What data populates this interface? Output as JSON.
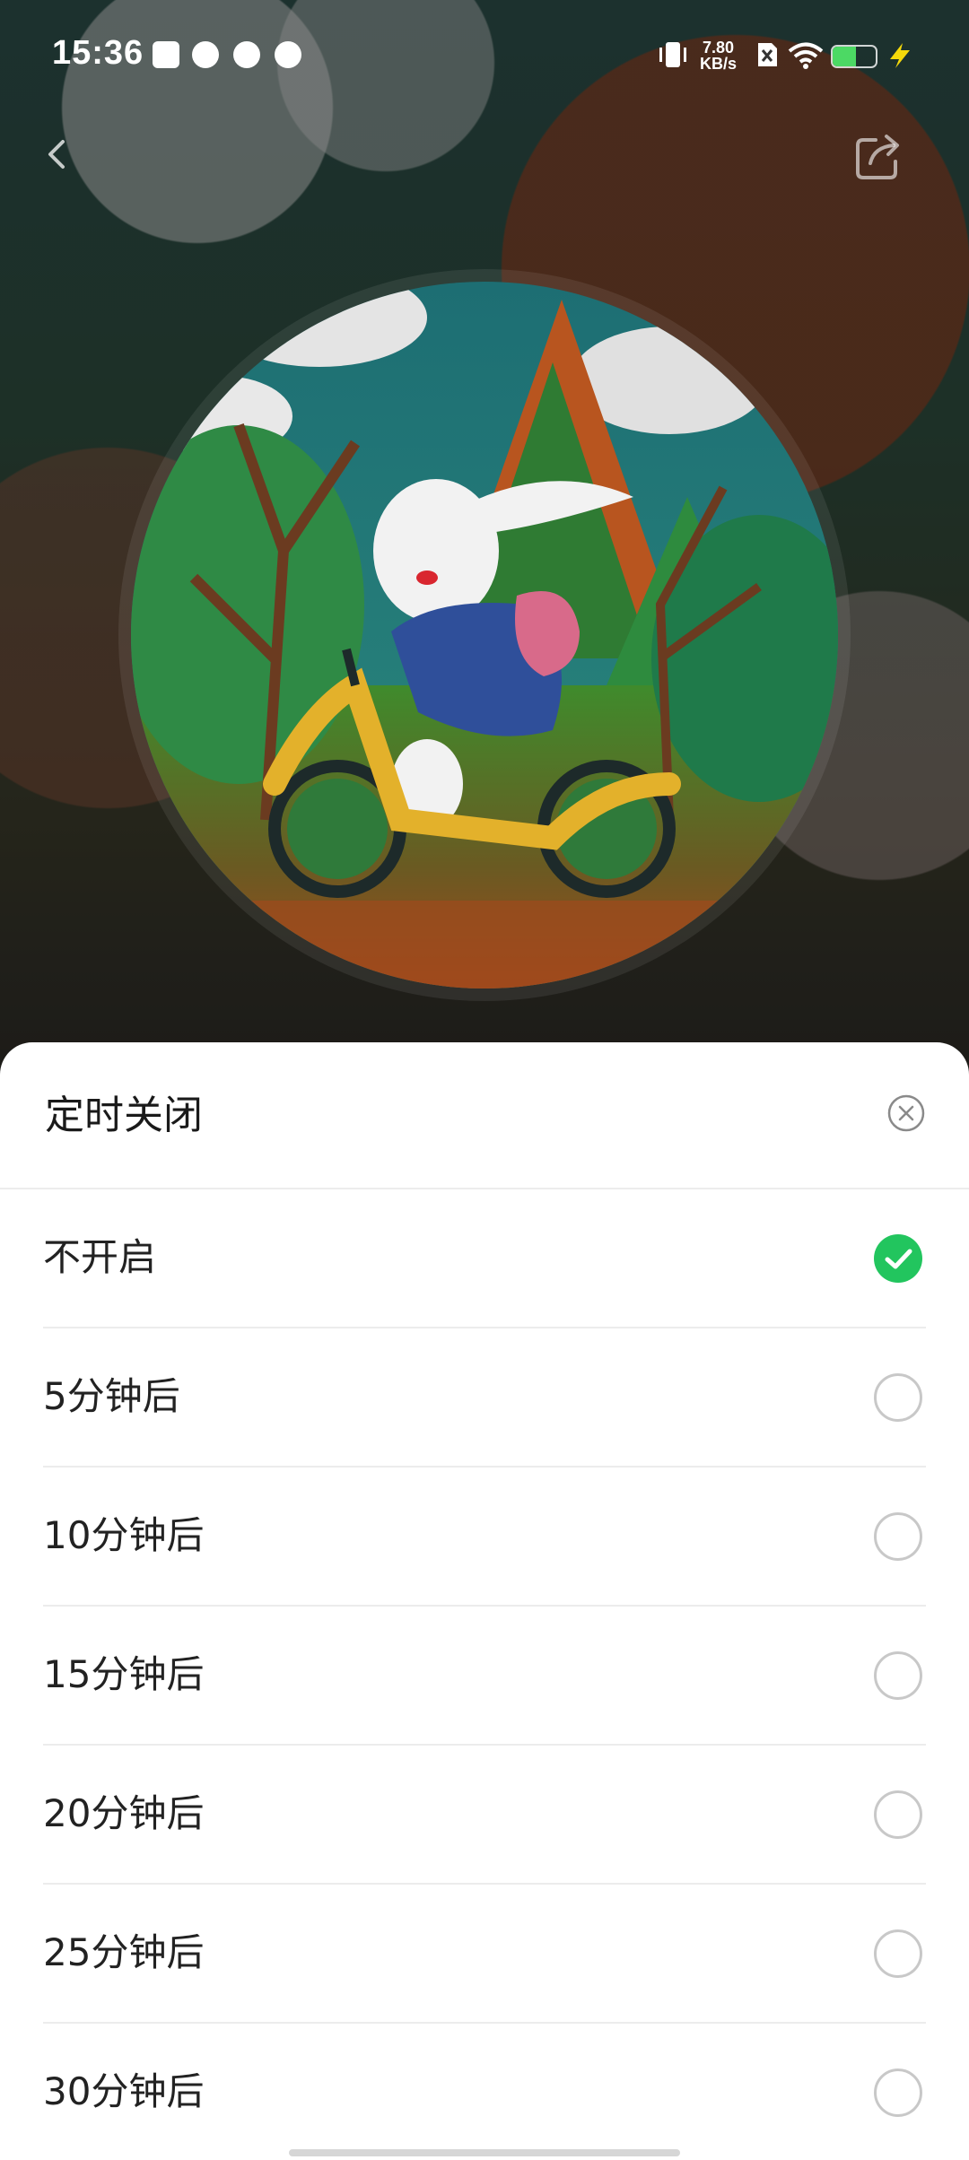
{
  "status_bar": {
    "time": "15:36",
    "net_speed_value": "7.80",
    "net_speed_unit": "KB/s",
    "battery_level": 0.55,
    "icons": [
      "gallery-icon",
      "wechat-icon",
      "music-disc-icon",
      "planet-icon",
      "vibrate-icon",
      "sim-off-icon",
      "wifi-icon",
      "battery-icon",
      "charging-icon"
    ]
  },
  "nav": {
    "back_icon": "chevron-left-icon",
    "share_icon": "share-icon"
  },
  "sleep_timer_sheet": {
    "title": "定时关闭",
    "close_icon": "close-circle-icon",
    "selected_index": 0,
    "accent_color": "#22c55e",
    "options": [
      {
        "label": "不开启"
      },
      {
        "label": "5分钟后"
      },
      {
        "label": "10分钟后"
      },
      {
        "label": "15分钟后"
      },
      {
        "label": "20分钟后"
      },
      {
        "label": "25分钟后"
      },
      {
        "label": "30分钟后"
      }
    ]
  }
}
